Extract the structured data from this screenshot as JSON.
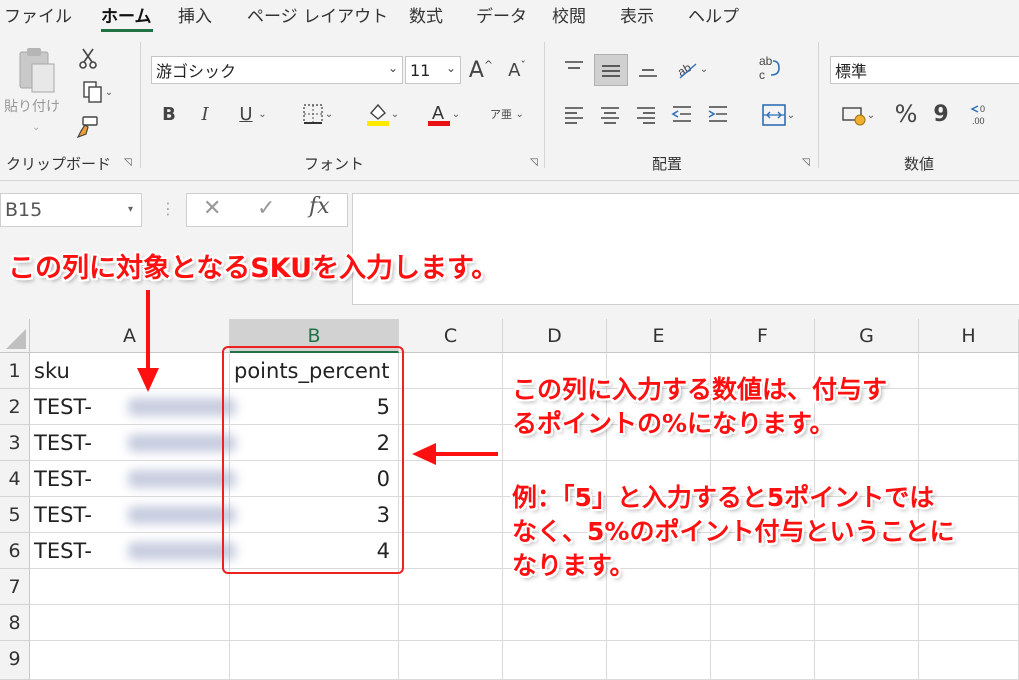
{
  "menu": {
    "tabs": [
      "ファイル",
      "ホーム",
      "挿入",
      "ページ レイアウト",
      "数式",
      "データ",
      "校閲",
      "表示",
      "ヘルプ"
    ],
    "active_index": 1
  },
  "ribbon": {
    "clipboard": {
      "paste_label": "貼り付け",
      "group_label": "クリップボード"
    },
    "font": {
      "font_name": "游ゴシック",
      "font_size": "11",
      "group_label": "フォント",
      "furigana_label": "ア亜"
    },
    "alignment": {
      "group_label": "配置"
    },
    "number": {
      "format": "標準",
      "group_label": "数値",
      "percent_symbol": "%",
      "comma_symbol": "9"
    }
  },
  "formula_bar": {
    "name_box": "B15",
    "fx_label": "fx",
    "formula": ""
  },
  "sheet": {
    "columns": [
      "A",
      "B",
      "C",
      "D",
      "E",
      "F",
      "G",
      "H"
    ],
    "selected_column": "B",
    "rows": [
      "1",
      "2",
      "3",
      "4",
      "5",
      "6",
      "7",
      "8",
      "9"
    ],
    "header": {
      "sku": "sku",
      "points_percent": "points_percent"
    },
    "data_rows": [
      {
        "sku": "TEST-",
        "points": "5"
      },
      {
        "sku": "TEST-",
        "points": "2"
      },
      {
        "sku": "TEST-",
        "points": "0"
      },
      {
        "sku": "TEST-",
        "points": "3"
      },
      {
        "sku": "TEST-",
        "points": "4"
      }
    ]
  },
  "annotations": {
    "top": "この列に対象となるSKUを入力します。",
    "right_line1": "この列に入力する数値は、付与す",
    "right_line2": "るポイントの%になります。",
    "example_line1": "例：「5」と入力すると5ポイントでは",
    "example_line2": "なく、5%のポイント付与ということに",
    "example_line3": "なります。"
  },
  "colors": {
    "accent": "#217346",
    "annotation": "#ff1010",
    "ribbon_bg": "#f3f3f3"
  },
  "icons": [
    "cut-icon",
    "copy-icon",
    "format-painter-icon",
    "paste-icon",
    "bold-icon",
    "italic-icon",
    "underline-icon",
    "border-icon",
    "fill-color-icon",
    "font-color-icon",
    "wrap-text-icon",
    "merge-center-icon",
    "currency-icon",
    "increase-decimal-icon",
    "cancel-icon",
    "enter-icon"
  ]
}
